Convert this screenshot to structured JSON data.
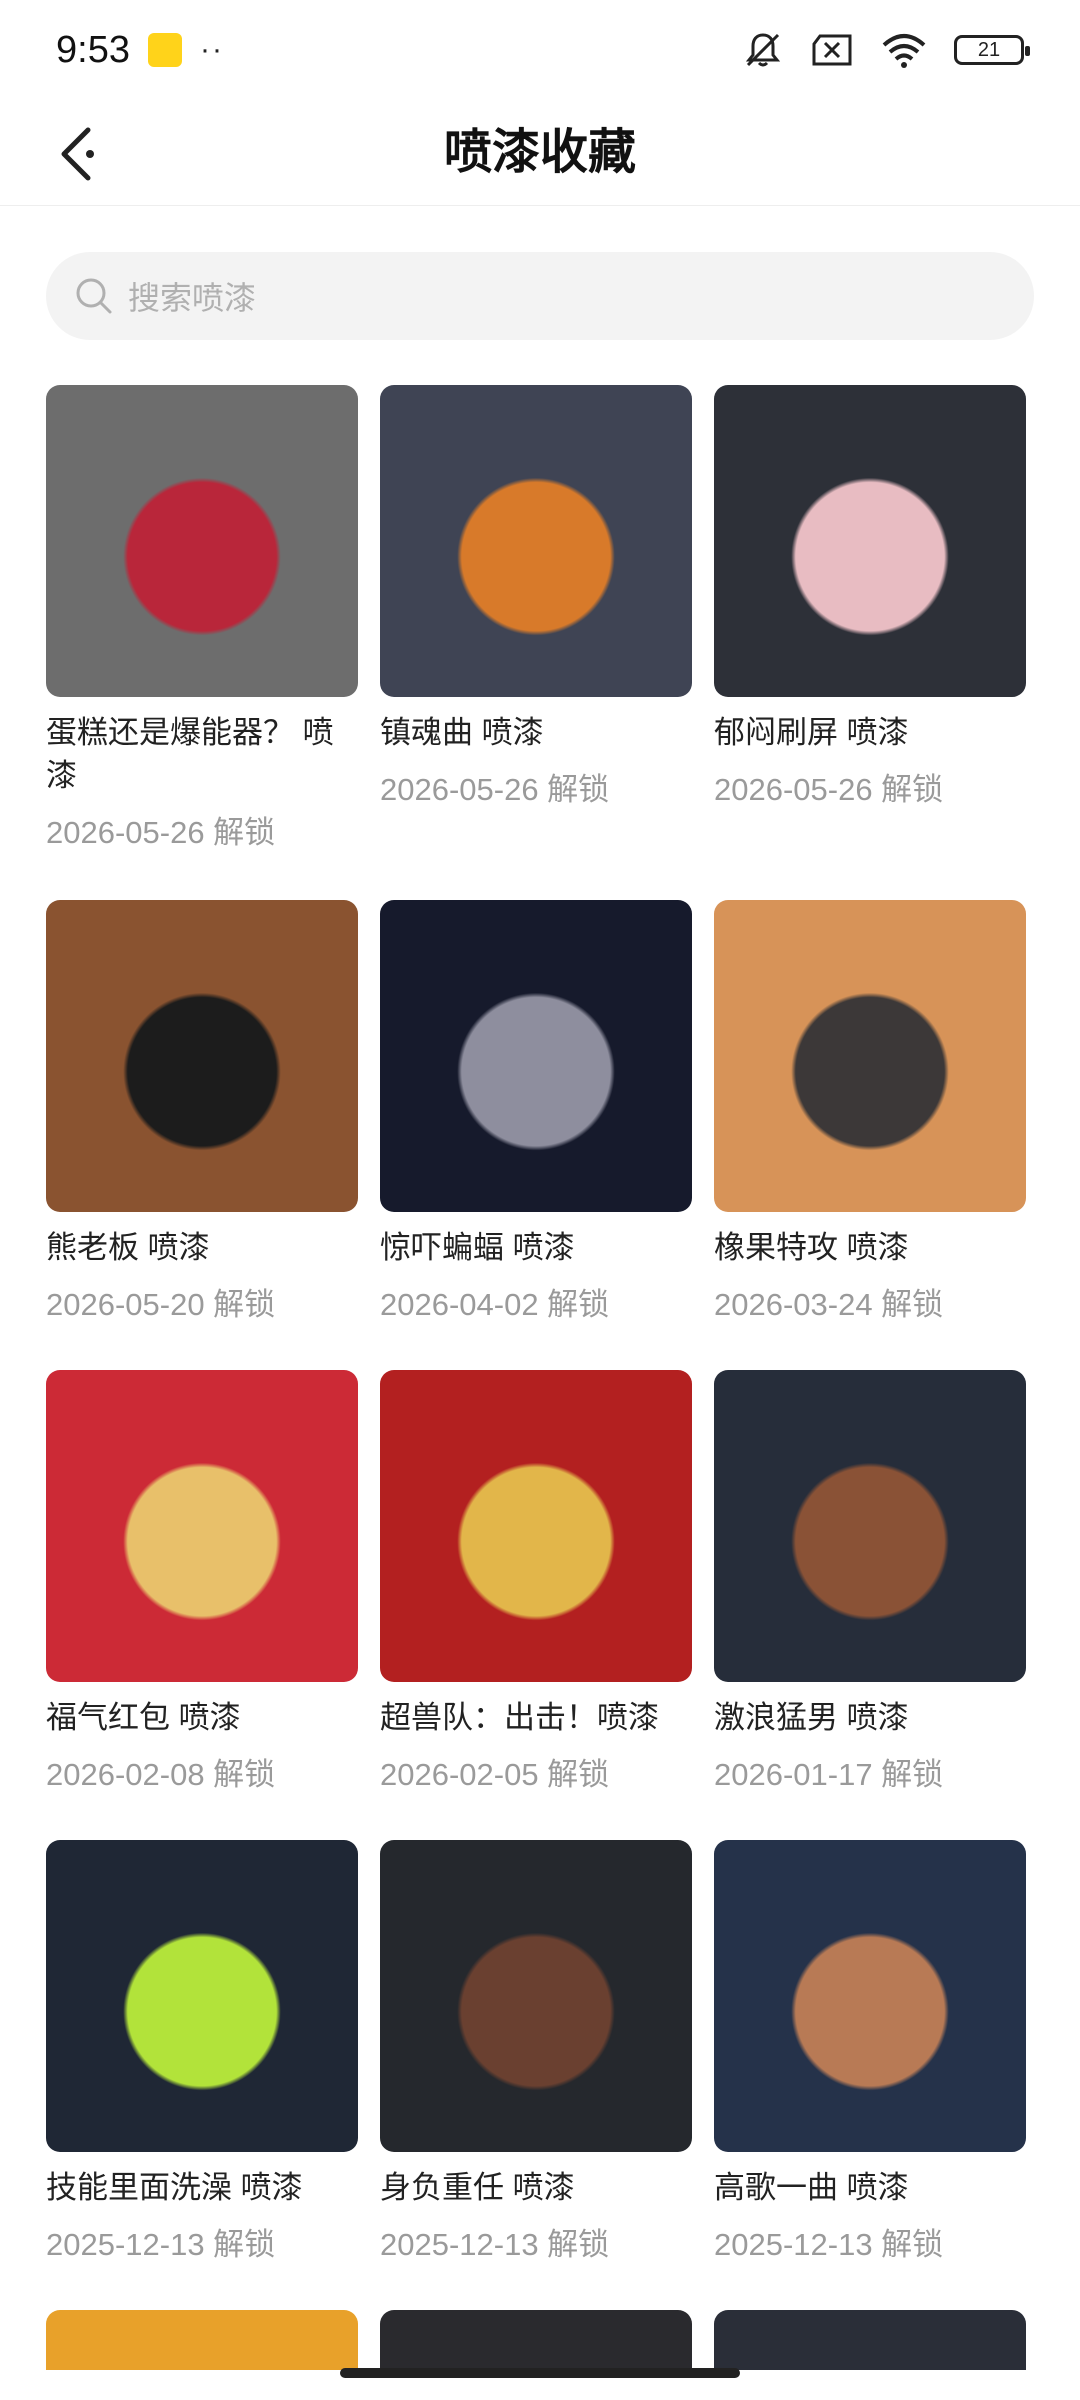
{
  "status_bar": {
    "time": "9:53",
    "dots": "··",
    "battery": "21"
  },
  "header": {
    "title": "喷漆收藏"
  },
  "search": {
    "placeholder": "搜索喷漆"
  },
  "items": [
    {
      "title": "蛋糕还是爆能器？ 喷漆",
      "date": "2026-05-26 解锁",
      "colors": [
        "#6d6d6d",
        "#b9263a"
      ]
    },
    {
      "title": "镇魂曲 喷漆",
      "date": "2026-05-26 解锁",
      "colors": [
        "#3f4454",
        "#d87a2a"
      ]
    },
    {
      "title": "郁闷刷屏 喷漆",
      "date": "2026-05-26 解锁",
      "colors": [
        "#2d3038",
        "#e8bcc2"
      ]
    },
    {
      "title": "熊老板 喷漆",
      "date": "2026-05-20 解锁",
      "colors": [
        "#8a5330",
        "#1c1c1c"
      ]
    },
    {
      "title": "惊吓蝙蝠 喷漆",
      "date": "2026-04-02 解锁",
      "colors": [
        "#161a2c",
        "#8e8e9e"
      ]
    },
    {
      "title": "橡果特攻 喷漆",
      "date": "2026-03-24 解锁",
      "colors": [
        "#d79358",
        "#3c3838"
      ]
    },
    {
      "title": "福气红包 喷漆",
      "date": "2026-02-08 解锁",
      "colors": [
        "#cc2a36",
        "#e8c06a"
      ]
    },
    {
      "title": "超兽队：出击！喷漆",
      "date": "2026-02-05 解锁",
      "colors": [
        "#b32020",
        "#e2b64a"
      ]
    },
    {
      "title": "激浪猛男 喷漆",
      "date": "2026-01-17 解锁",
      "colors": [
        "#262d3a",
        "#8a5236"
      ]
    },
    {
      "title": "技能里面洗澡 喷漆",
      "date": "2025-12-13 解锁",
      "colors": [
        "#1f2735",
        "#b2e33a"
      ]
    },
    {
      "title": "身负重任 喷漆",
      "date": "2025-12-13 解锁",
      "colors": [
        "#25282d",
        "#6a4030"
      ]
    },
    {
      "title": "高歌一曲 喷漆",
      "date": "2025-12-13 解锁",
      "colors": [
        "#25324a",
        "#b87a55"
      ]
    }
  ],
  "partial_colors": [
    "#e8a12a",
    "#2a2a2e",
    "#2a2e38"
  ]
}
